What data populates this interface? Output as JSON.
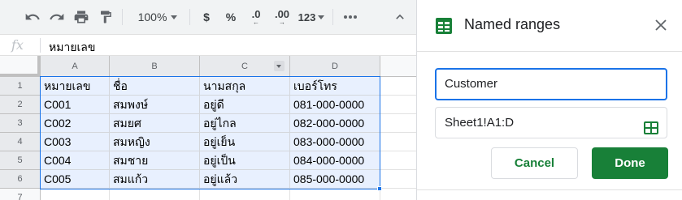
{
  "toolbar": {
    "zoom": "100%",
    "currency": "$",
    "percent": "%",
    "dec_decrease": ".0",
    "dec_increase": ".00",
    "more_formats": "123"
  },
  "formula_bar": {
    "fx": "fx",
    "value": "หมายเลข"
  },
  "grid": {
    "columns": [
      "A",
      "B",
      "C",
      "D"
    ],
    "row_numbers": [
      "1",
      "2",
      "3",
      "4",
      "5",
      "6",
      "7"
    ],
    "rows": [
      [
        "หมายเลข",
        "ชื่อ",
        "นามสกุล",
        "เบอร์โทร"
      ],
      [
        "C001",
        "สมพงษ์",
        "อยู่ดี",
        "081-000-0000"
      ],
      [
        "C002",
        "สมยศ",
        "อยู่ไกล",
        "082-000-0000"
      ],
      [
        "C003",
        "สมหญิง",
        "อยู่เย็น",
        "083-000-0000"
      ],
      [
        "C004",
        "สมชาย",
        "อยู่เป็น",
        "084-000-0000"
      ],
      [
        "C005",
        "สมแก้ว",
        "อยู่แล้ว",
        "085-000-0000"
      ]
    ]
  },
  "panel": {
    "title": "Named ranges",
    "name_value": "Customer",
    "range_value": "Sheet1!A1:D",
    "cancel_label": "Cancel",
    "done_label": "Done"
  },
  "colors": {
    "accent_green": "#188038",
    "selection_blue": "#1a73e8",
    "selection_fill": "#e8f0fe"
  }
}
